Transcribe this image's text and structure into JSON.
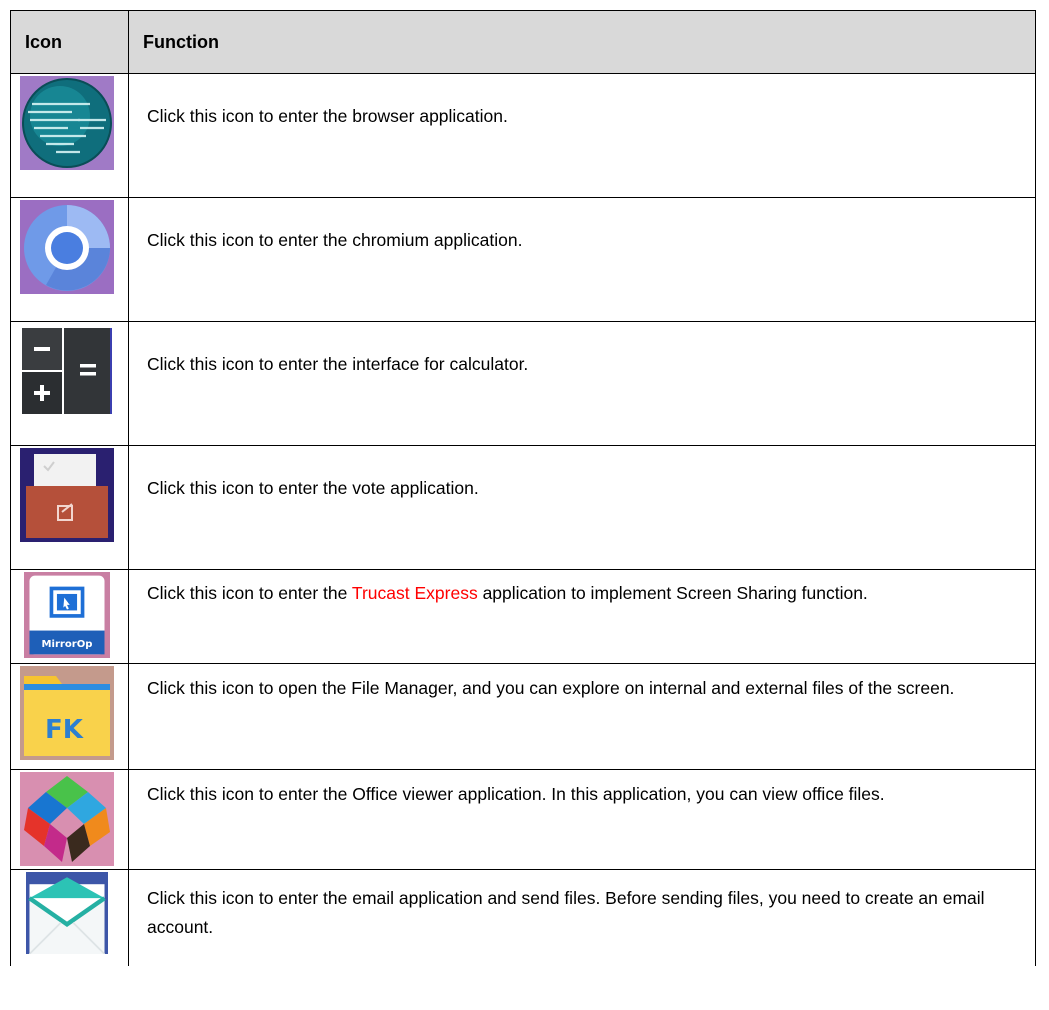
{
  "table": {
    "headers": {
      "icon": "Icon",
      "function": "Function"
    },
    "rows": [
      {
        "icon": "globe-icon",
        "text": "Click this icon to enter the browser application."
      },
      {
        "icon": "chromium-icon",
        "text": "Click this icon to enter the chromium application."
      },
      {
        "icon": "calculator-icon",
        "text": "Click this icon to enter the interface for calculator."
      },
      {
        "icon": "vote-icon",
        "text": "Click this icon to enter the vote application."
      },
      {
        "icon": "mirrorop-icon",
        "text_before": "Click this icon to enter the ",
        "highlight": "Trucast Express",
        "text_after": " application to implement Screen Sharing function.",
        "icon_caption": "MirrorOp",
        "highlight_color": "#ff0000"
      },
      {
        "icon": "file-manager-icon",
        "text": "Click this icon to open the File Manager, and you can explore on internal and external files of the screen.",
        "icon_caption": "FK"
      },
      {
        "icon": "office-viewer-icon",
        "text": "Click this icon to enter the Office viewer application. In this application, you can view office files."
      },
      {
        "icon": "email-icon",
        "text": "Click this icon to enter the email application and send files. Before sending files, you need to create an email account."
      }
    ]
  }
}
